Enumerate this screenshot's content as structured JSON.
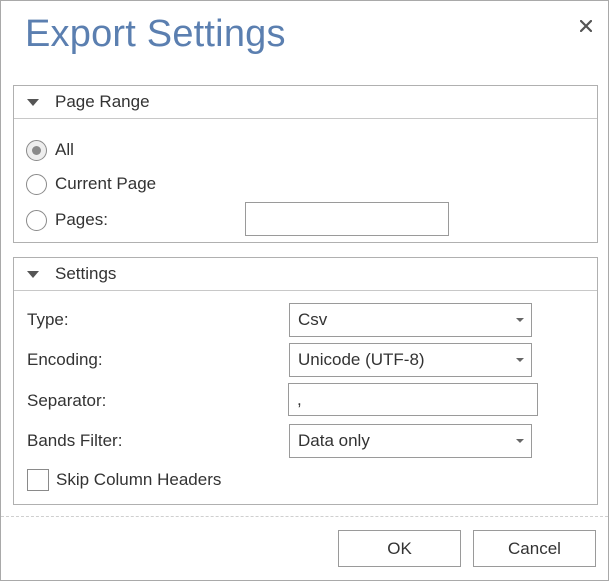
{
  "dialog": {
    "title": "Export Settings",
    "close_glyph": "×"
  },
  "page_range": {
    "header": "Page Range",
    "options": [
      {
        "label": "All",
        "checked": true
      },
      {
        "label": "Current Page",
        "checked": false
      },
      {
        "label": "Pages:",
        "checked": false
      }
    ],
    "pages_value": ""
  },
  "settings": {
    "header": "Settings",
    "type_label": "Type:",
    "type_value": "Csv",
    "encoding_label": "Encoding:",
    "encoding_value": "Unicode (UTF-8)",
    "separator_label": "Separator:",
    "separator_value": ",",
    "bands_filter_label": "Bands Filter:",
    "bands_filter_value": "Data only",
    "skip_headers_label": "Skip Column Headers",
    "skip_headers_checked": false
  },
  "footer": {
    "ok_label": "OK",
    "cancel_label": "Cancel"
  },
  "colors": {
    "title": "#5b7fb0",
    "border": "#b0b0b0"
  }
}
